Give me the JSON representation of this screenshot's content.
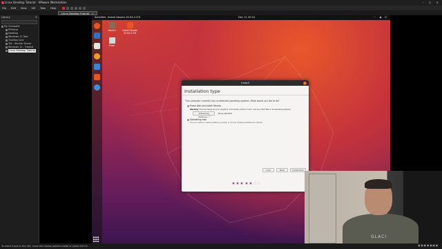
{
  "window": {
    "title": "Linux Desktop Tutorial - VMware Workstation"
  },
  "menu": {
    "items": [
      "File",
      "Edit",
      "View",
      "VM",
      "Tabs",
      "Help"
    ]
  },
  "tab": {
    "label": "Linux Desktop Tutorial"
  },
  "library": {
    "title": "Library",
    "tree": [
      {
        "label": "My Computer",
        "level": 0
      },
      {
        "label": "PFSense",
        "level": 1
      },
      {
        "label": "Desktop",
        "level": 1
      },
      {
        "label": "Windows 11 Test",
        "level": 1
      },
      {
        "label": "TrueNas Core",
        "level": 1
      },
      {
        "label": "Tail - Ubuntu Server",
        "level": 1
      },
      {
        "label": "Windows 11 - Tutorial",
        "level": 1
      },
      {
        "label": "Linux Desktop Tutorial",
        "level": 1,
        "selected": true
      }
    ]
  },
  "statusbar": {
    "text": "To direct input to this VM, move the mouse pointer inside or press Ctrl+G."
  },
  "guest": {
    "activities": "Activities",
    "app_name": "Install Ubuntu 20.04.3 LTS",
    "clock": "Dec 11 20:10",
    "desktop_icons": [
      "ubuntu",
      "Install Ubuntu 20.04.3 LTS",
      "Trash"
    ]
  },
  "installer": {
    "window_title": "Install",
    "heading": "Installation type",
    "question": "This computer currently has no detected operating systems. What would you like to do?",
    "option1": "Erase disk and install Ubuntu",
    "warning_label": "Warning:",
    "warning_text": "This will delete all your programs, documents, photos, music, and any other files in all operating systems.",
    "advanced_button": "Advanced features...",
    "advanced_value": "None selected",
    "option2": "Something else",
    "option2_note": "You can create or resize partitions yourself, or choose multiple partitions for Ubuntu.",
    "quit": "Quit",
    "back": "Back",
    "install_now": "Install Now",
    "progress": {
      "total": 7,
      "completed": 5
    }
  },
  "webcam": {
    "shirt_text": "GLACI"
  },
  "colors": {
    "ubuntu_orange": "#e95420",
    "aubergine": "#6a1e5b"
  }
}
